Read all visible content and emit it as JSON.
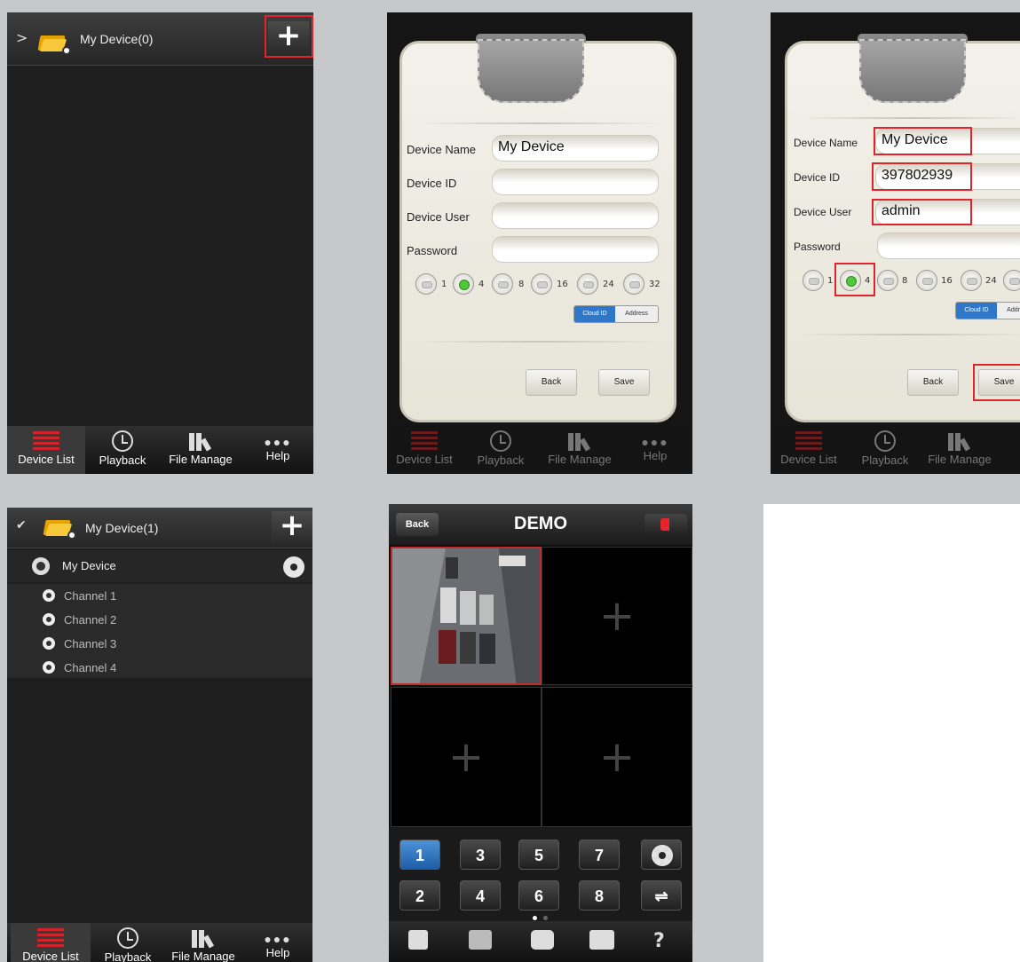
{
  "tabs": [
    {
      "label": "Device List",
      "icon": "device-list-icon"
    },
    {
      "label": "Playback",
      "icon": "clock-icon"
    },
    {
      "label": "File Manage",
      "icon": "file-manage-icon"
    },
    {
      "label": "Help",
      "icon": "more-dots-icon"
    }
  ],
  "screen1": {
    "title": "My Device(0)"
  },
  "dialog_a": {
    "labels": {
      "name": "Device Name",
      "id": "Device ID",
      "user": "Device User",
      "password": "Password"
    },
    "values": {
      "name": "My Device",
      "id": "",
      "user": "",
      "password": ""
    },
    "channels": [
      "1",
      "4",
      "8",
      "16",
      "24",
      "32"
    ],
    "selected_channel": "4",
    "mode_options": [
      "Cloud ID",
      "Address"
    ],
    "mode_selected": "Cloud ID",
    "back": "Back",
    "save": "Save"
  },
  "dialog_b": {
    "labels": {
      "name": "Device Name",
      "id": "Device ID",
      "user": "Device User",
      "password": "Password"
    },
    "values": {
      "name": "My Device",
      "id": "397802939",
      "user": "admin",
      "password": ""
    },
    "channels": [
      "1",
      "4",
      "8",
      "16",
      "24"
    ],
    "mode_options": [
      "Cloud ID",
      "Address"
    ],
    "back": "Back",
    "save": "Save"
  },
  "screen4": {
    "title": "My Device(1)",
    "device": "My Device",
    "channels": [
      "Channel 1",
      "Channel 2",
      "Channel 3",
      "Channel 4"
    ]
  },
  "live": {
    "back": "Back",
    "title": "DEMO",
    "buttons_row1": [
      "1",
      "3",
      "5",
      "7"
    ],
    "buttons_row2": [
      "2",
      "4",
      "6",
      "8"
    ],
    "help": "?"
  },
  "colors": {
    "highlight_red": "#e0242c",
    "active_blue": "#2f77c9",
    "radio_green": "#4fc83a"
  }
}
